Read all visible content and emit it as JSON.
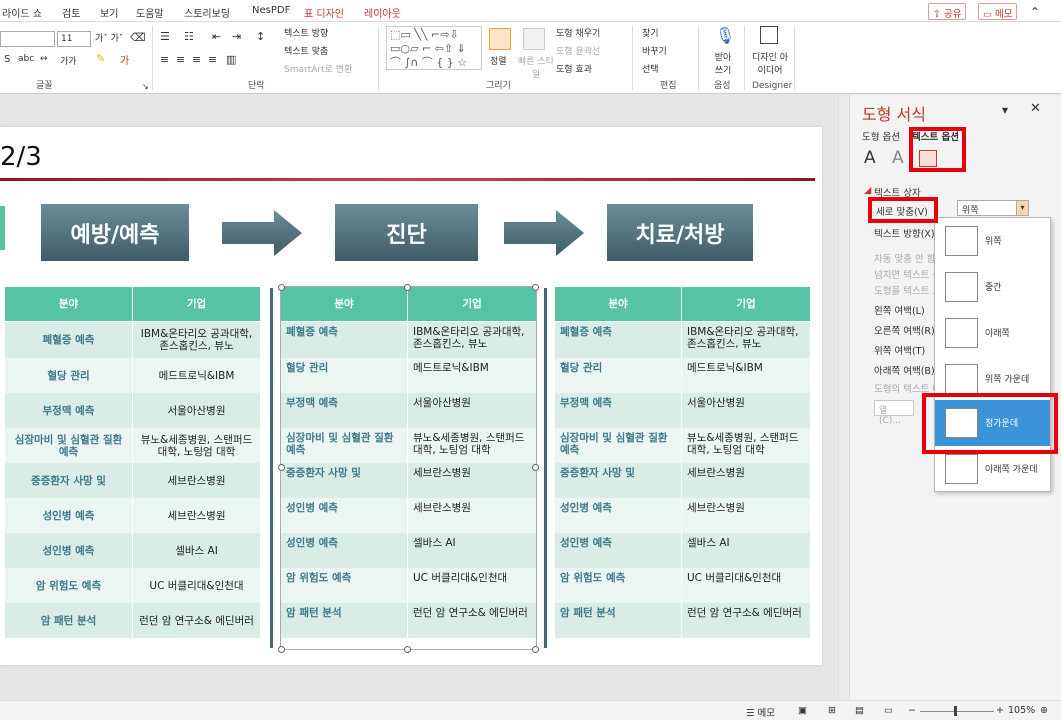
{
  "tabs": [
    "라이드 쇼",
    "검토",
    "보기",
    "도움말",
    "스토리보딩",
    "NesPDF",
    "표 디자인",
    "레이아웃"
  ],
  "share_label": "공유",
  "memo_label": "메모",
  "ribbon": {
    "font_size": "11",
    "groups": {
      "font": "글꼴",
      "paragraph": "단락",
      "drawing": "그리기",
      "edit": "편집",
      "voice": "음성",
      "designer": "Designer"
    },
    "text_direction": "텍스트 방향",
    "text_align": "텍스트 맞춤",
    "smartart": "SmartArt로 변환",
    "arrange": "정렬",
    "quick_style": "빠른 스타일",
    "shape_fill": "도형 채우기",
    "shape_outline": "도형 윤곽선",
    "shape_effect": "도형 효과",
    "find": "찾기",
    "replace": "바꾸기",
    "select": "선택",
    "dictate": "받아 쓰기",
    "design_ideas": "디자인 아이디어"
  },
  "slide": {
    "title_fragment": "2/3",
    "phases": [
      "예방/예측",
      "진단",
      "치료/처방"
    ],
    "table_header": [
      "분야",
      "기업"
    ],
    "rows": [
      [
        "폐혈증 예측",
        "IBM&온타리오 공과대학, 존스홉킨스, 뷰노"
      ],
      [
        "혈당 관리",
        "메드트로닉&IBM"
      ],
      [
        "부정맥 예측",
        "서울아산병원"
      ],
      [
        "심장마비 및 심혈관 질환 예측",
        "뷰노&세종병원, 스탠퍼드 대학, 노팅엄 대학"
      ],
      [
        "중증환자 사망 및",
        "세브란스병원"
      ],
      [
        "성인병 예측",
        "세브란스병원"
      ],
      [
        "성인병 예측",
        "셀바스 AI"
      ],
      [
        "암 위험도 예측",
        "UC 버클리대&인천대"
      ],
      [
        "암 패턴 분석",
        "런던 암 연구소& 에딘버러"
      ]
    ]
  },
  "panel": {
    "title": "도형 서식",
    "tab_shape": "도형 옵션",
    "tab_text": "텍스트 옵션",
    "section": "텍스트 상자",
    "vertical_align_label": "세로 맞춤(V)",
    "vertical_align_value": "위쪽",
    "text_direction_label": "텍스트 방향(X)",
    "autofit_none": "자동 맞춤 안 함",
    "autofit_shrink": "넘치면 텍스트 축소",
    "autofit_resize": "도형을 텍스트 크기에 맞춤",
    "margin_left": "왼쪽 여백(L)",
    "margin_right": "오른쪽 여백(R)",
    "margin_top": "위쪽 여백(T)",
    "margin_bottom": "아래쪽 여백(B)",
    "wrap_text": "도형의 텍스트 배치",
    "columns_button": "열(C)...",
    "options": [
      "위쪽",
      "중간",
      "아래쪽",
      "위쪽 가운데",
      "정가운데",
      "아래쪽 가운데"
    ],
    "selected_option": "정가운데"
  },
  "status": {
    "notes": "메모",
    "zoom": "105%"
  }
}
